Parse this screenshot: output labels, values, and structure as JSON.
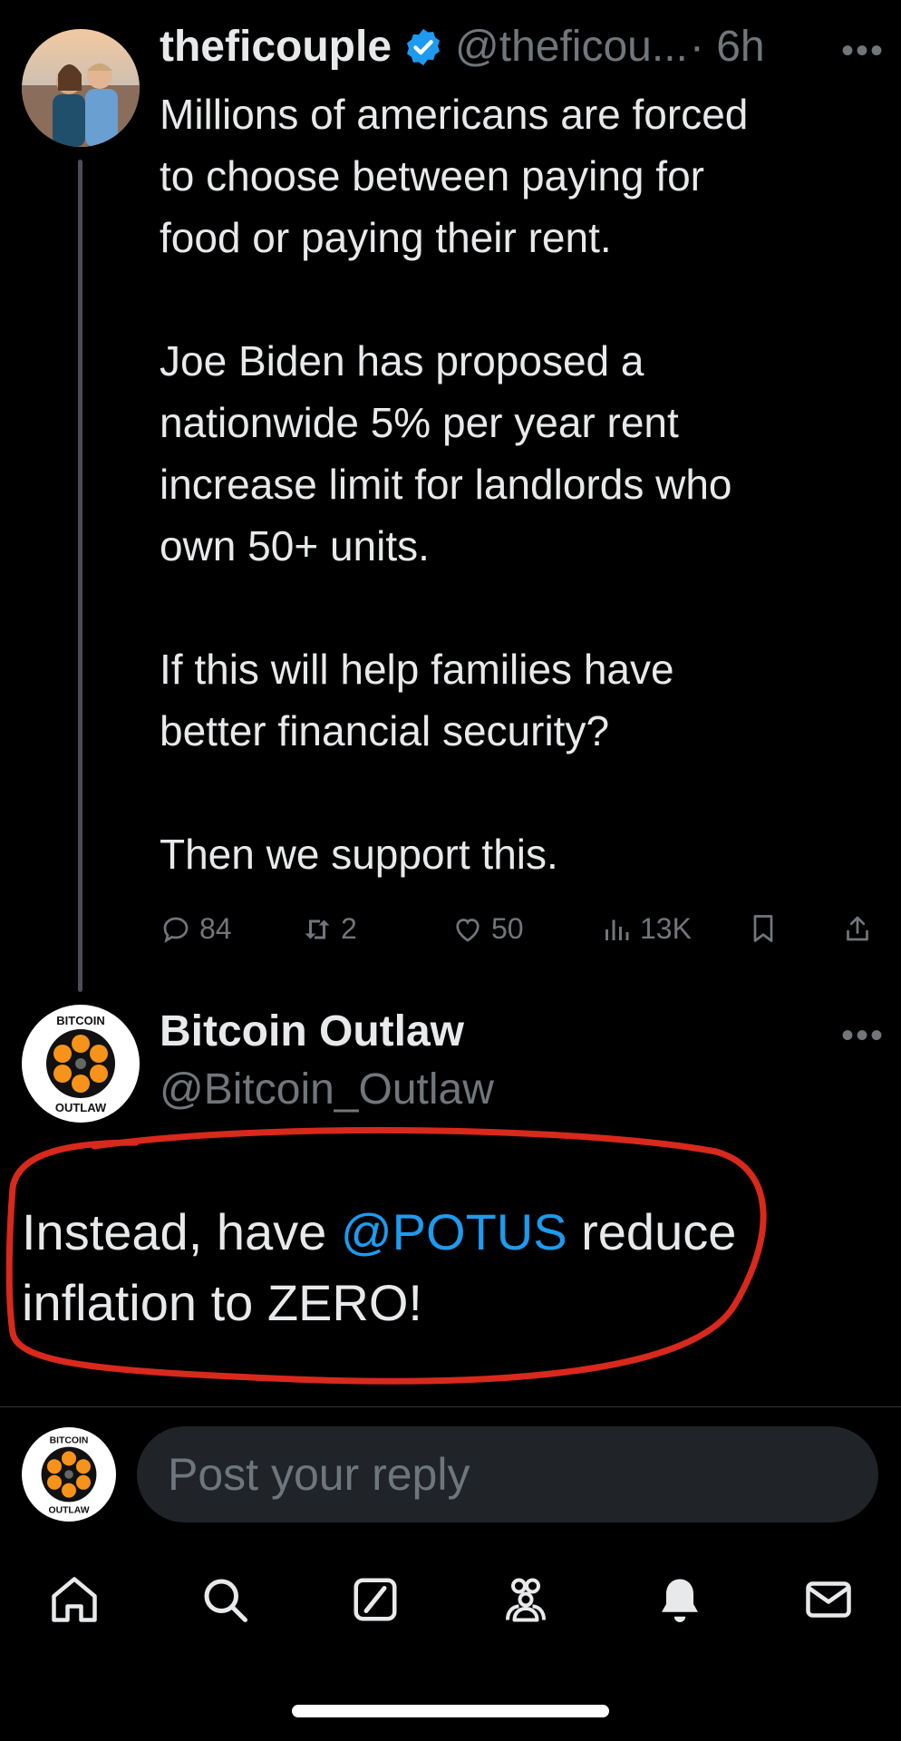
{
  "tweet": {
    "author_name": "theficouple",
    "author_handle": "@theficou...",
    "time": "· 6h",
    "text": "Millions of americans are forced\nto choose between paying for\nfood or paying their rent.\n\nJoe Biden has proposed a\nnationwide 5% per year rent\nincrease limit for landlords who\nown 50+ units.\n\nIf this will help families have\nbetter financial security?\n\nThen we support this.",
    "replies": "84",
    "reposts": "2",
    "likes": "50",
    "views": "13K"
  },
  "reply": {
    "author_name": "Bitcoin Outlaw",
    "author_handle": "@Bitcoin_Outlaw",
    "text_before": "Instead, have ",
    "mention": "@POTUS",
    "text_after": " reduce inflation to ZERO!"
  },
  "avatar_logo": {
    "top_text": "BITCOIN",
    "bottom_text": "OUTLAW"
  },
  "composer": {
    "placeholder": "Post your reply"
  },
  "colors": {
    "accent": "#1d9bf0",
    "verified": "#1d9bf0",
    "annotation_circle": "#d8291c"
  },
  "icons": [
    "home-icon",
    "search-icon",
    "grok-icon",
    "communities-icon",
    "notifications-icon",
    "messages-icon"
  ]
}
